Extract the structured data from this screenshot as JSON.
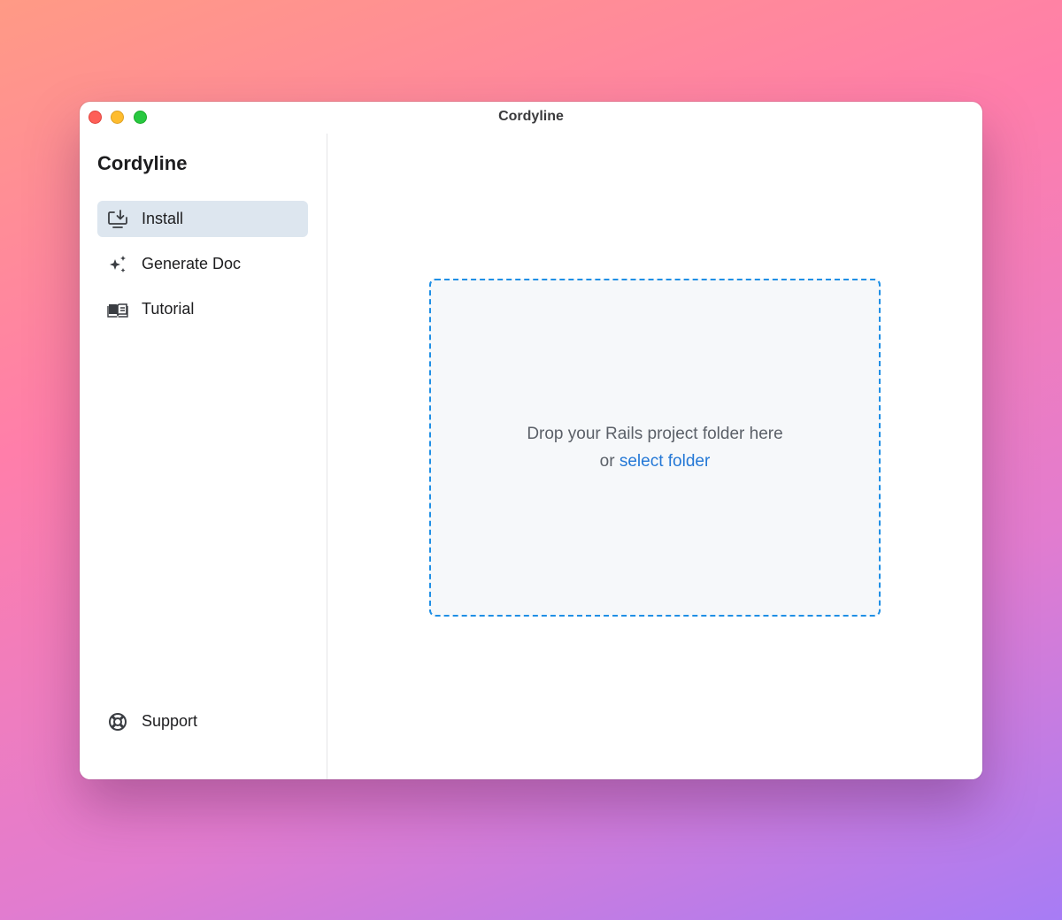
{
  "window": {
    "title": "Cordyline"
  },
  "sidebar": {
    "app_name": "Cordyline",
    "items": [
      {
        "label": "Install",
        "icon": "install-icon",
        "active": true
      },
      {
        "label": "Generate Doc",
        "icon": "sparkles-icon",
        "active": false
      },
      {
        "label": "Tutorial",
        "icon": "book-icon",
        "active": false
      }
    ],
    "support": {
      "label": "Support",
      "icon": "lifebuoy-icon"
    }
  },
  "dropzone": {
    "line1": "Drop your Rails project folder here",
    "or_text": "or",
    "link_text": "select folder"
  },
  "colors": {
    "accent": "#1f8fe5",
    "link": "#2478d6",
    "active_item_bg": "#dde6ef",
    "traffic_close": "#fe5f57",
    "traffic_minimize": "#febc2e",
    "traffic_zoom": "#28c840"
  }
}
